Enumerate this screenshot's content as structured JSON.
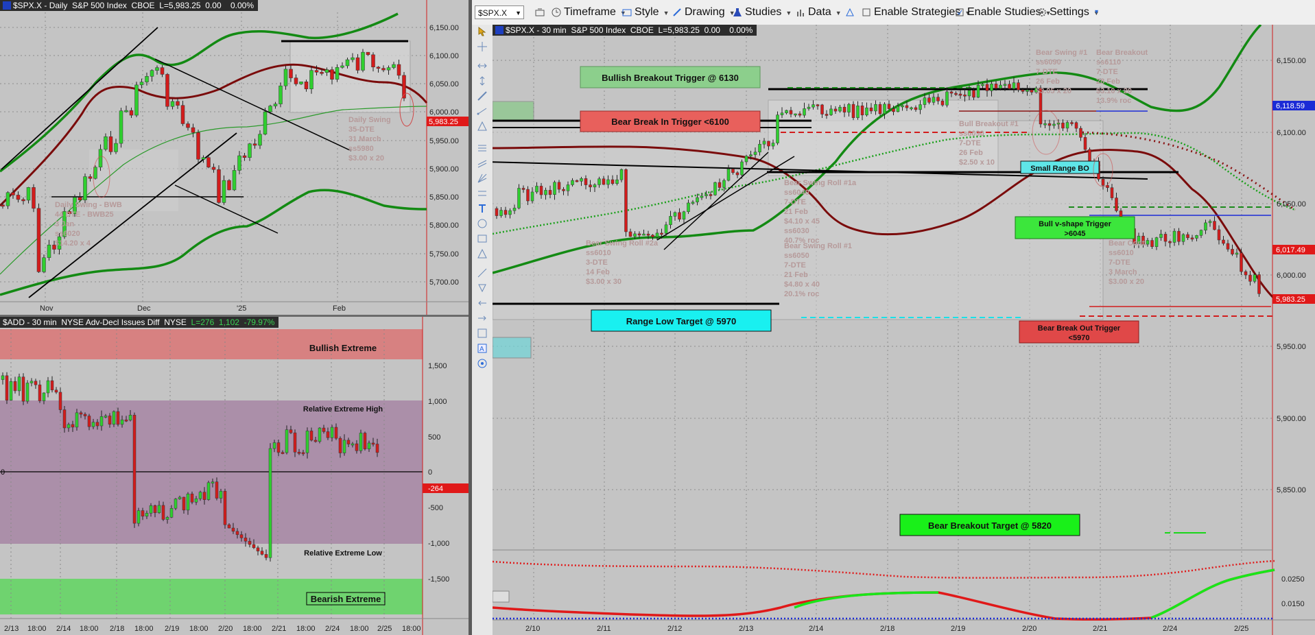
{
  "daily_panel": {
    "title": "$SPX.X - Daily  S&P 500 Index  CBOE  L=5,983.25  0.00    0.00%",
    "price_labels": [
      "6,150.00",
      "6,100.00",
      "6,050.00",
      "6,000.00",
      "5,950.00",
      "5,900.00",
      "5,850.00",
      "5,800.00",
      "5,750.00",
      "5,700.00"
    ],
    "last_price": "5,983.25",
    "date_labels": [
      "Nov",
      "Dec",
      "'25",
      "Feb"
    ],
    "notes": {
      "daily_swing_bwb": [
        "Daily Swing - BWB",
        "44 DTE - BWB25",
        "3 Jan",
        "ss6020",
        "$14.20 x 4"
      ],
      "daily_swing": [
        "Daily Swing",
        "35-DTE",
        "31 March",
        "ss5980",
        "$3.00 x 20"
      ]
    }
  },
  "add_panel": {
    "title": "$ADD - 30 min  NYSE Adv-Decl Issues Diff  NYSE  ",
    "last_value": "L=276  1,102  -79.97%",
    "value_labels": [
      "1,500",
      "1,000",
      "500",
      "0",
      "-500",
      "-1,000",
      "-1,500"
    ],
    "current_value": "-264",
    "zero_label": "0",
    "zones": {
      "bullish_extreme": "Bullish Extreme",
      "relative_extreme_high": "Relative Extreme High",
      "relative_extreme_low": "Relative Extreme Low",
      "bearish_extreme": "Bearish Extreme"
    },
    "time_labels": [
      "2/13",
      "18:00",
      "2/14",
      "18:00",
      "2/18",
      "18:00",
      "2/19",
      "18:00",
      "2/20",
      "18:00",
      "2/21",
      "18:00",
      "2/24",
      "18:00",
      "2/25",
      "18:00"
    ]
  },
  "toolbar": {
    "symbol": "$SPX.X",
    "timeframe": "Timeframe",
    "style": "Style",
    "drawing": "Drawing",
    "studies": "Studies",
    "data": "Data",
    "enable_strategies": "Enable Strategies",
    "enable_studies": "Enable Studies",
    "settings": "Settings"
  },
  "intraday_panel": {
    "title": "$SPX.X - 30 min  S&P 500 Index  CBOE  L=5,983.25  0.00    0.00%",
    "price_labels": [
      "6,150.00",
      "6,100.00",
      "6,050.00",
      "6,000.00",
      "5,950.00",
      "5,900.00",
      "5,850.00"
    ],
    "price_tags": {
      "blue": "6,118.59",
      "red_upper": "6,017.49",
      "red_lower": "5,983.25"
    },
    "osc_labels": [
      "0.0250",
      "0.0150"
    ],
    "date_labels": [
      "2/10",
      "2/11",
      "2/12",
      "2/13",
      "2/14",
      "2/18",
      "2/19",
      "2/20",
      "2/21",
      "2/24",
      "2/25"
    ],
    "annotations": {
      "bullish_breakout_trigger": "Bullish Breakout Trigger @ 6130",
      "bear_break_in_trigger": "Bear Break In Trigger <6100",
      "range_low_target": "Range Low Target @ 5970",
      "small_range_bo": "Small Range BO",
      "bull_vshape_trigger": [
        "Bull v-shape Trigger",
        ">6045"
      ],
      "bear_break_out_trigger": [
        "Bear Break Out Trigger",
        "<5970"
      ],
      "bear_breakout_target": "Bear Breakout Target @ 5820"
    },
    "notes": {
      "swing_roll_2a": [
        "Bear Swing Roll #2a",
        "ss6010",
        "3-DTE",
        "14 Feb",
        "$3.00 x 30"
      ],
      "swing_roll_1a": [
        "Bear Swing Roll #1a",
        "ss6040",
        "7-DTE",
        "21 Feb",
        "$4.10 x 45",
        "ss6030",
        "40.7% roc"
      ],
      "swing_roll_1": [
        "Bear Swing Roll #1",
        "ss6050",
        "7-DTE",
        "21 Feb",
        "$4.80 x 40",
        "20.1% roc"
      ],
      "bull_breakout": [
        "Bull Breakout #1",
        "ss6090",
        "7-DTE",
        "26 Feb",
        "$2.50 x 10"
      ],
      "bear_swing_1": [
        "Bear Swing #1",
        "ss6090",
        "7-DTE",
        "26 Feb",
        "$3.05 x 20"
      ],
      "bear_breakout": [
        "Bear Breakout",
        "ss6110",
        "7-DTE",
        "28 Feb",
        "$3.10 x 20",
        "13.9% roc"
      ],
      "bear_cont": [
        "Bear Cont.",
        "ss6010",
        "7-DTE",
        "3 March",
        "$3.00 x 20"
      ]
    }
  },
  "colors": {
    "green": "#138a13",
    "maroon": "#7a0b0b",
    "red": "#d21c1c",
    "blue": "#1b2bd6",
    "cyan": "#19e0e8"
  }
}
